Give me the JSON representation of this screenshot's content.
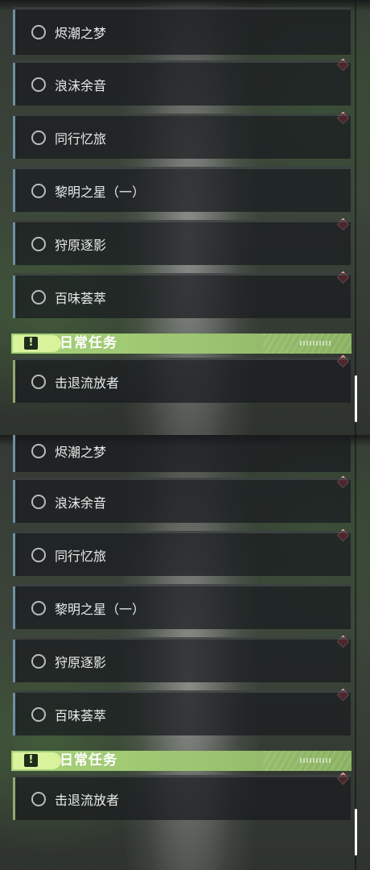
{
  "quests": [
    {
      "label": "烬潮之梦"
    },
    {
      "label": "浪沫余音"
    },
    {
      "label": "同行忆旅"
    },
    {
      "label": "黎明之星（一）"
    },
    {
      "label": "狩原逐影"
    },
    {
      "label": "百味荟萃"
    }
  ],
  "daily_header": {
    "title": "日常任务",
    "icon": "exclamation-alert-icon"
  },
  "daily_quests": [
    {
      "label": "击退流放者"
    }
  ],
  "colors": {
    "accent_green": "#a6d27a",
    "marker_red": "#d8404e",
    "story_bar_blue": "#6f8fa3"
  }
}
